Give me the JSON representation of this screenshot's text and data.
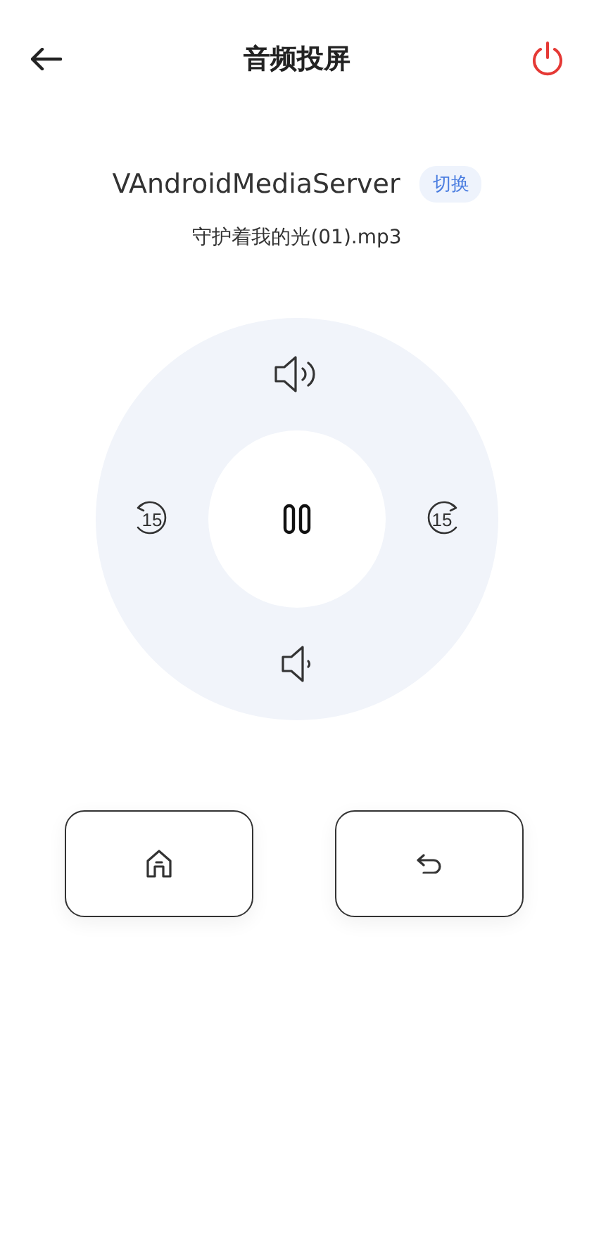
{
  "header": {
    "title": "音频投屏"
  },
  "device": {
    "name": "VAndroidMediaServer",
    "switch_label": "切换"
  },
  "track": {
    "file": "守护着我的光(01).mp3"
  },
  "player": {
    "playing": true,
    "skip_back": "15",
    "skip_forward": "15"
  },
  "nav_buttons": [
    {
      "kind": "home"
    },
    {
      "kind": "back"
    }
  ]
}
